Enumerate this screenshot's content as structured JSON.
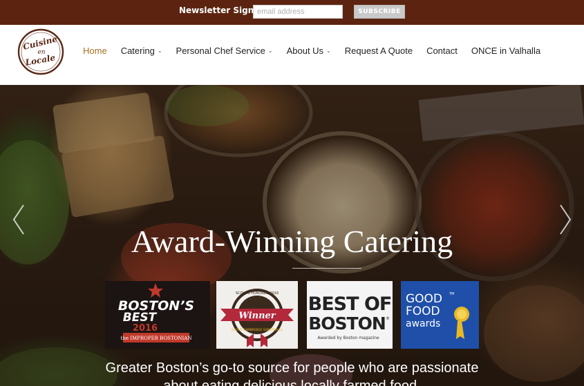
{
  "newsletter": {
    "label": "Newsletter Signup",
    "email_placeholder": "email address",
    "subscribe_label": "SUBSCRIBE"
  },
  "logo": {
    "line1": "Cuisine",
    "line2": "en",
    "line3": "Locale"
  },
  "nav": {
    "items": [
      {
        "label": "Home",
        "active": true
      },
      {
        "label": "Catering",
        "has_dropdown": true
      },
      {
        "label": "Personal Chef Service",
        "has_dropdown": true
      },
      {
        "label": "About Us",
        "has_dropdown": true
      },
      {
        "label": "Request A Quote"
      },
      {
        "label": "Contact"
      },
      {
        "label": "ONCE in Valhalla"
      }
    ],
    "caret": "⌄"
  },
  "hero": {
    "title": "Award-Winning Catering",
    "tagline_line1": "Greater Boston’s go-to source for people who are passionate",
    "tagline_line2": "about eating delicious locally farmed food."
  },
  "badges": {
    "bostons_best": {
      "line1": "BOSTON’S",
      "line2": "BEST",
      "year": "2016",
      "banner": "the IMPROPER BOSTONIAN"
    },
    "winner": {
      "ribbon_top": "SCOUTS HONORED 2016",
      "word": "Winner",
      "ribbon_bottom": "SCOUT CAMBRIDGE SOMERVILLE"
    },
    "best_of_boston": {
      "line1": "BEST OF",
      "line2": "BOSTON",
      "reg": "®",
      "footer": "Awarded by Boston magazine"
    },
    "good_food": {
      "line1": "GOOD",
      "line2": "FOOD",
      "tm": "TM",
      "line3": "awards"
    }
  },
  "colors": {
    "topbar": "#5c2410",
    "nav_active": "#a4701f",
    "logo_brown": "#5a2716",
    "good_food_blue": "#1f4fa8",
    "bostons_best_red": "#c0392b",
    "medal_gold": "#e8b923"
  },
  "icons": {
    "prev": "chevron-left-icon",
    "next": "chevron-right-icon",
    "dropdown": "chevron-down-icon"
  }
}
